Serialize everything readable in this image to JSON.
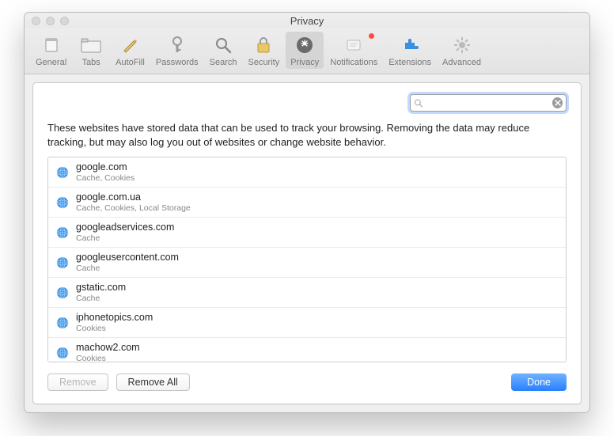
{
  "window": {
    "title": "Privacy"
  },
  "toolbar": {
    "items": [
      {
        "label": "General",
        "icon": "general"
      },
      {
        "label": "Tabs",
        "icon": "tabs"
      },
      {
        "label": "AutoFill",
        "icon": "autofill"
      },
      {
        "label": "Passwords",
        "icon": "passwords"
      },
      {
        "label": "Search",
        "icon": "search"
      },
      {
        "label": "Security",
        "icon": "security"
      },
      {
        "label": "Privacy",
        "icon": "privacy",
        "selected": true
      },
      {
        "label": "Notifications",
        "icon": "notifications",
        "badge": true
      },
      {
        "label": "Extensions",
        "icon": "extensions"
      },
      {
        "label": "Advanced",
        "icon": "advanced"
      }
    ]
  },
  "privacy_panel": {
    "search_value": "",
    "search_placeholder": "",
    "description": "These websites have stored data that can be used to track your browsing. Removing the data may reduce tracking, but may also log you out of websites or change website behavior.",
    "sites": [
      {
        "domain": "google.com",
        "detail": "Cache, Cookies"
      },
      {
        "domain": "google.com.ua",
        "detail": "Cache, Cookies, Local Storage"
      },
      {
        "domain": "googleadservices.com",
        "detail": "Cache"
      },
      {
        "domain": "googleusercontent.com",
        "detail": "Cache"
      },
      {
        "domain": "gstatic.com",
        "detail": "Cache"
      },
      {
        "domain": "iphonetopics.com",
        "detail": "Cookies"
      },
      {
        "domain": "machow2.com",
        "detail": "Cookies"
      }
    ],
    "buttons": {
      "remove": "Remove",
      "remove_all": "Remove All",
      "done": "Done"
    }
  }
}
